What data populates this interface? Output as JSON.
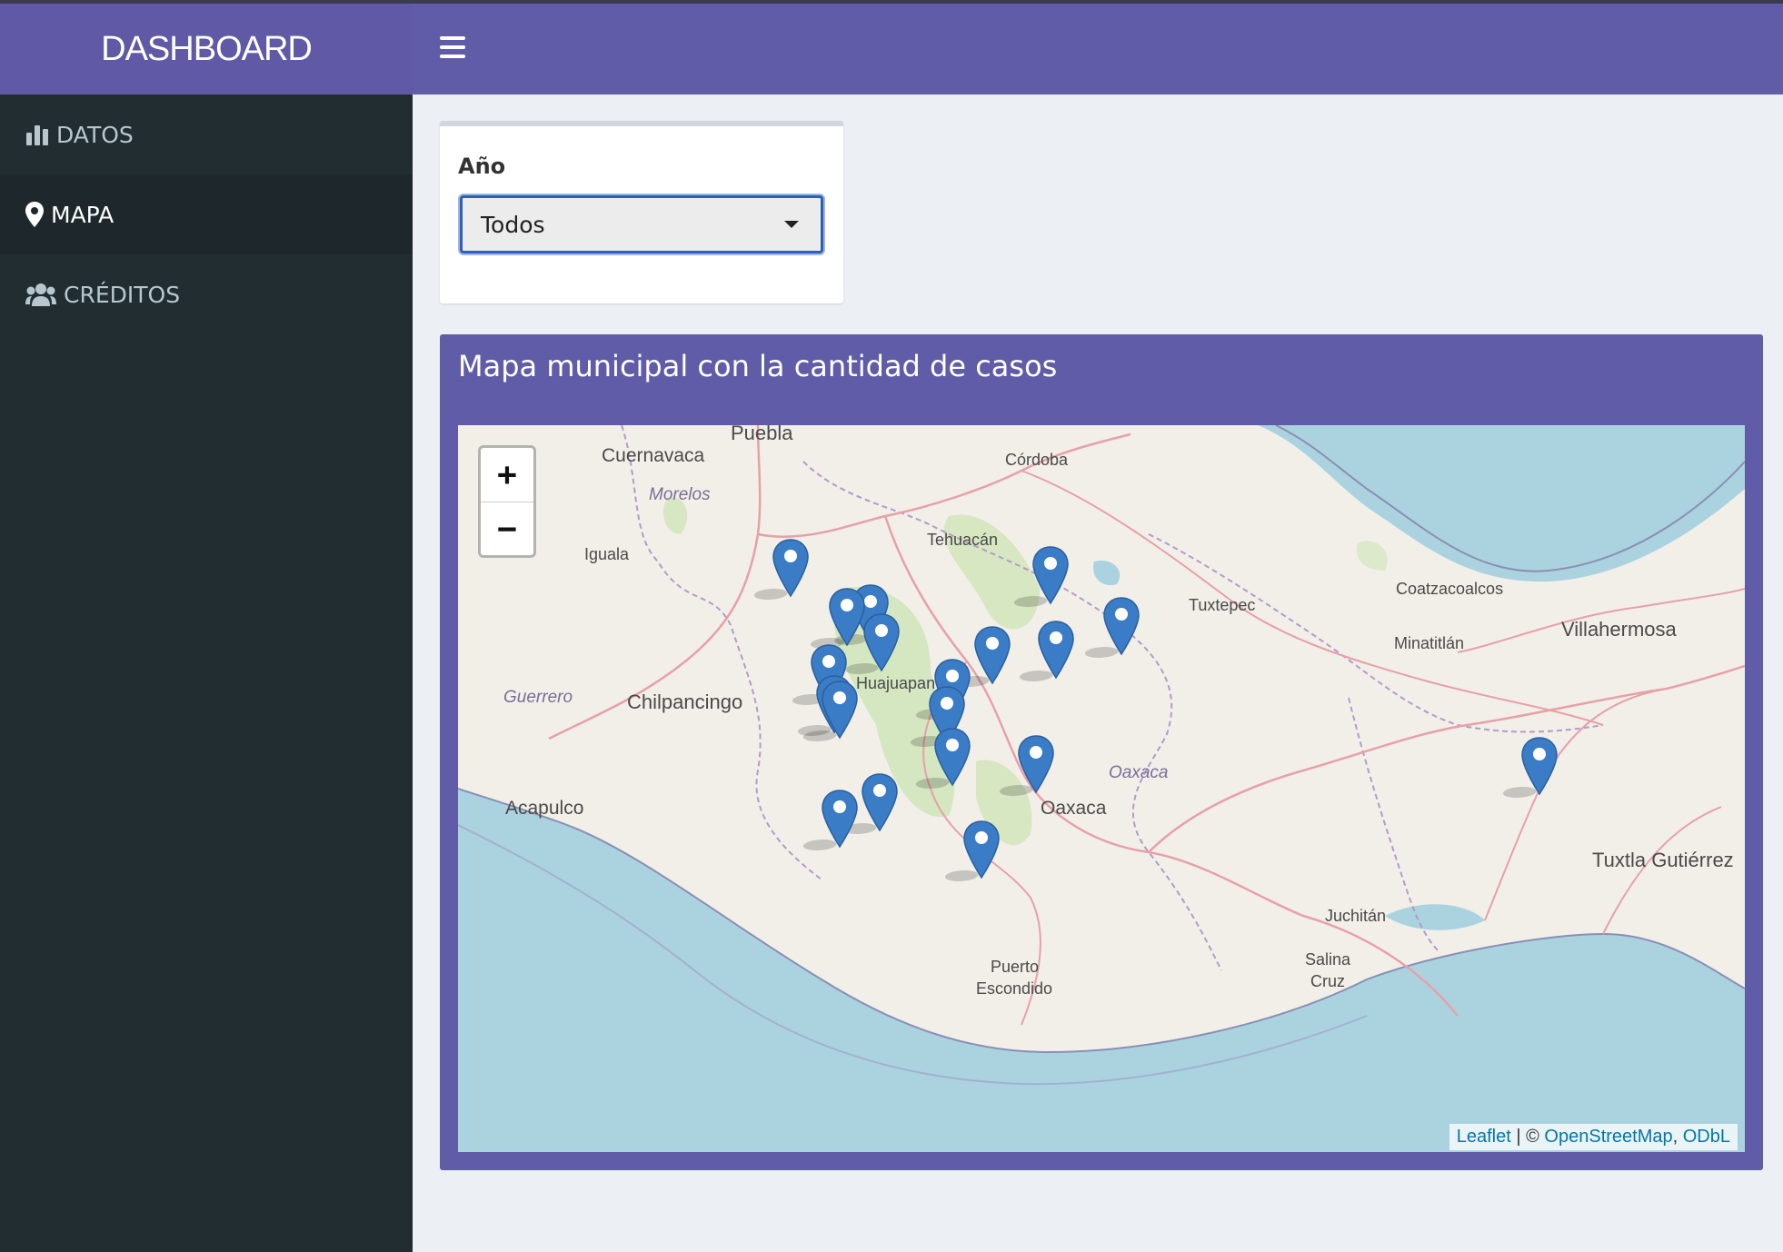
{
  "header": {
    "brand": "DASHBOARD"
  },
  "sidebar": {
    "items": [
      {
        "label": "DATOS",
        "icon": "bar-chart-icon",
        "active": false
      },
      {
        "label": "MAPA",
        "icon": "map-marker-icon",
        "active": true
      },
      {
        "label": "CRÉDITOS",
        "icon": "users-icon",
        "active": false
      }
    ]
  },
  "filter": {
    "label": "Año",
    "selected": "Todos"
  },
  "map": {
    "title": "Mapa municipal con la cantidad de casos",
    "zoom_in": "+",
    "zoom_out": "−",
    "attribution": {
      "leaflet": "Leaflet",
      "sep": " | © ",
      "osm": "OpenStreetMap",
      "comma": ", ",
      "odbl": "ODbL"
    },
    "place_labels": [
      "Puebla",
      "Cuernavaca",
      "Córdoba",
      "Morelos",
      "Tehuacán",
      "Iguala",
      "Coatzacoalcos",
      "Villahermosa",
      "Minatitlán",
      "Guerrero",
      "Chilpancingo",
      "Huajuapan",
      "Oaxaca",
      "Acapulco",
      "Tuxtla Gutiérrez",
      "Juchitán",
      "Salina",
      "Cruz",
      "Puerto",
      "Escondido",
      "Tuxtepec",
      "Oaxaca"
    ],
    "marker_count": 19
  },
  "colors": {
    "brand": "#605ca8",
    "sidebar": "#222d32",
    "marker": "#3a7cc6",
    "water": "#aad3df",
    "land": "#f2efe9"
  }
}
